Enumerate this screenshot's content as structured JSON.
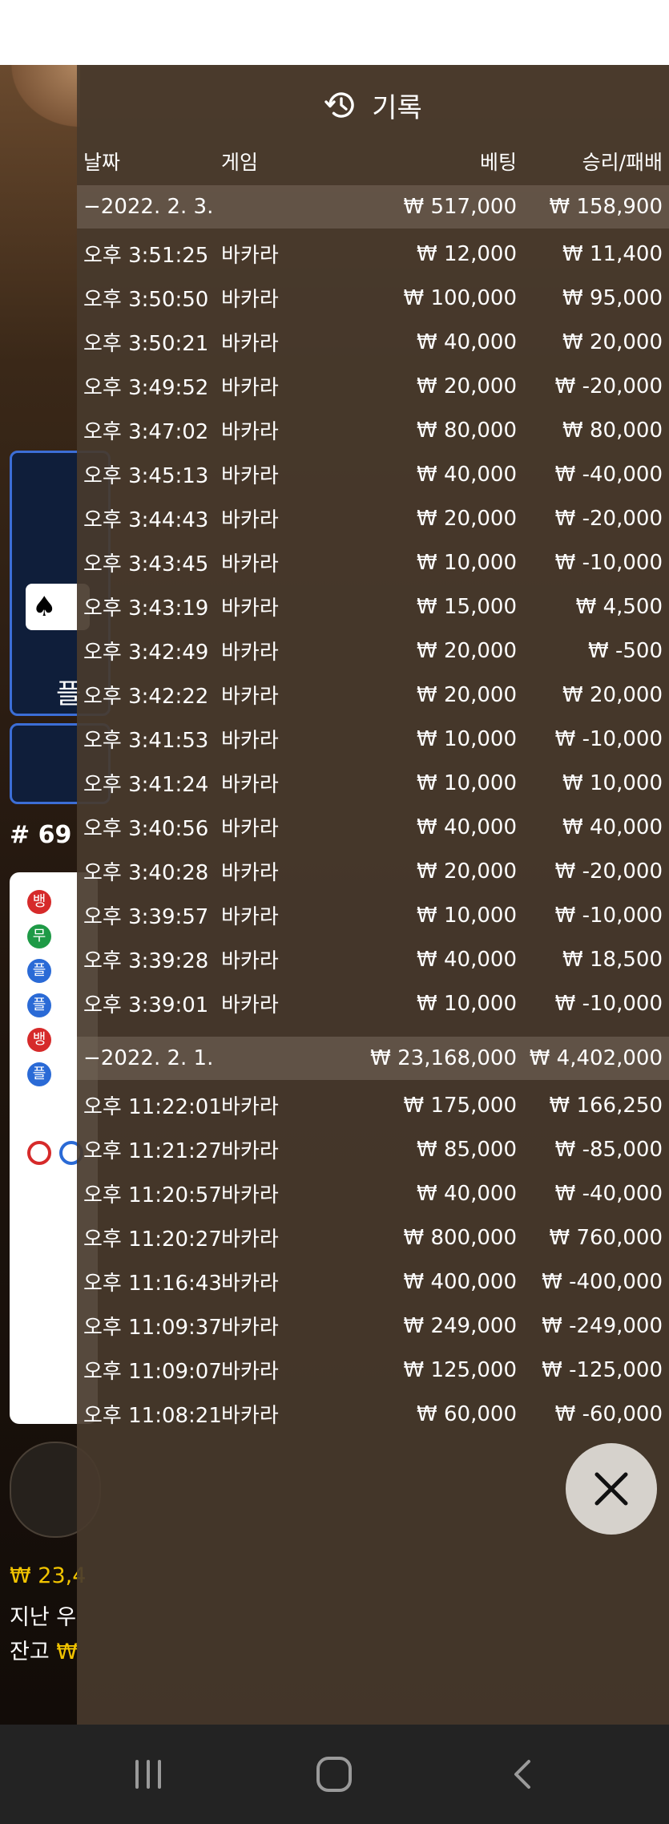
{
  "panel": {
    "title": "기록",
    "headers": {
      "date": "날짜",
      "game": "게임",
      "bet": "베팅",
      "result": "승리/패배"
    }
  },
  "groups": [
    {
      "date": "−2022. 2. 3.",
      "total_bet": "₩ 517,000",
      "total_result": "₩ 158,900",
      "rows": [
        {
          "time": "오후 3:51:25",
          "game": "바카라",
          "bet": "₩ 12,000",
          "result": "₩ 11,400"
        },
        {
          "time": "오후 3:50:50",
          "game": "바카라",
          "bet": "₩ 100,000",
          "result": "₩ 95,000"
        },
        {
          "time": "오후 3:50:21",
          "game": "바카라",
          "bet": "₩ 40,000",
          "result": "₩ 20,000"
        },
        {
          "time": "오후 3:49:52",
          "game": "바카라",
          "bet": "₩ 20,000",
          "result": "₩ -20,000"
        },
        {
          "time": "오후 3:47:02",
          "game": "바카라",
          "bet": "₩ 80,000",
          "result": "₩ 80,000"
        },
        {
          "time": "오후 3:45:13",
          "game": "바카라",
          "bet": "₩ 40,000",
          "result": "₩ -40,000"
        },
        {
          "time": "오후 3:44:43",
          "game": "바카라",
          "bet": "₩ 20,000",
          "result": "₩ -20,000"
        },
        {
          "time": "오후 3:43:45",
          "game": "바카라",
          "bet": "₩ 10,000",
          "result": "₩ -10,000"
        },
        {
          "time": "오후 3:43:19",
          "game": "바카라",
          "bet": "₩ 15,000",
          "result": "₩ 4,500"
        },
        {
          "time": "오후 3:42:49",
          "game": "바카라",
          "bet": "₩ 20,000",
          "result": "₩ -500"
        },
        {
          "time": "오후 3:42:22",
          "game": "바카라",
          "bet": "₩ 20,000",
          "result": "₩ 20,000"
        },
        {
          "time": "오후 3:41:53",
          "game": "바카라",
          "bet": "₩ 10,000",
          "result": "₩ -10,000"
        },
        {
          "time": "오후 3:41:24",
          "game": "바카라",
          "bet": "₩ 10,000",
          "result": "₩ 10,000"
        },
        {
          "time": "오후 3:40:56",
          "game": "바카라",
          "bet": "₩ 40,000",
          "result": "₩ 40,000"
        },
        {
          "time": "오후 3:40:28",
          "game": "바카라",
          "bet": "₩ 20,000",
          "result": "₩ -20,000"
        },
        {
          "time": "오후 3:39:57",
          "game": "바카라",
          "bet": "₩ 10,000",
          "result": "₩ -10,000"
        },
        {
          "time": "오후 3:39:28",
          "game": "바카라",
          "bet": "₩ 40,000",
          "result": "₩ 18,500"
        },
        {
          "time": "오후 3:39:01",
          "game": "바카라",
          "bet": "₩ 10,000",
          "result": "₩ -10,000"
        }
      ]
    },
    {
      "date": "−2022. 2. 1.",
      "total_bet": "₩ 23,168,000",
      "total_result": "₩ 4,402,000",
      "rows": [
        {
          "time": "오후 11:22:01",
          "game": "바카라",
          "bet": "₩ 175,000",
          "result": "₩ 166,250"
        },
        {
          "time": "오후 11:21:27",
          "game": "바카라",
          "bet": "₩ 85,000",
          "result": "₩ -85,000"
        },
        {
          "time": "오후 11:20:57",
          "game": "바카라",
          "bet": "₩ 40,000",
          "result": "₩ -40,000"
        },
        {
          "time": "오후 11:20:27",
          "game": "바카라",
          "bet": "₩ 800,000",
          "result": "₩ 760,000"
        },
        {
          "time": "오후 11:16:43",
          "game": "바카라",
          "bet": "₩ 400,000",
          "result": "₩ -400,000"
        },
        {
          "time": "오후 11:09:37",
          "game": "바카라",
          "bet": "₩ 249,000",
          "result": "₩ -249,000"
        },
        {
          "time": "오후 11:09:07",
          "game": "바카라",
          "bet": "₩ 125,000",
          "result": "₩ -125,000"
        },
        {
          "time": "오후 11:08:21",
          "game": "바카라",
          "bet": "₩ 60,000",
          "result": "₩ -60,000"
        }
      ]
    }
  ],
  "background": {
    "round_label": "# 69",
    "card_fragment": "♠︎",
    "player_fragment": "플",
    "roadmap_labels": [
      "뱅",
      "무",
      "플",
      "플",
      "뱅",
      "플"
    ],
    "win_line": "₩ 23,4",
    "last_label": "지난 우",
    "balance_label": "잔고 ",
    "balance_value": "₩"
  },
  "colors": {
    "panel_bg": "#483a2c",
    "group_bg": "#786a5c",
    "accent_gold": "#f2c400",
    "banker_red": "#d62a2a",
    "player_blue": "#2a6ad6",
    "tie_green": "#1e9a46"
  },
  "icons": {
    "title": "history-icon",
    "close": "close-icon",
    "nav": [
      "recents-icon",
      "home-icon",
      "back-icon"
    ]
  }
}
